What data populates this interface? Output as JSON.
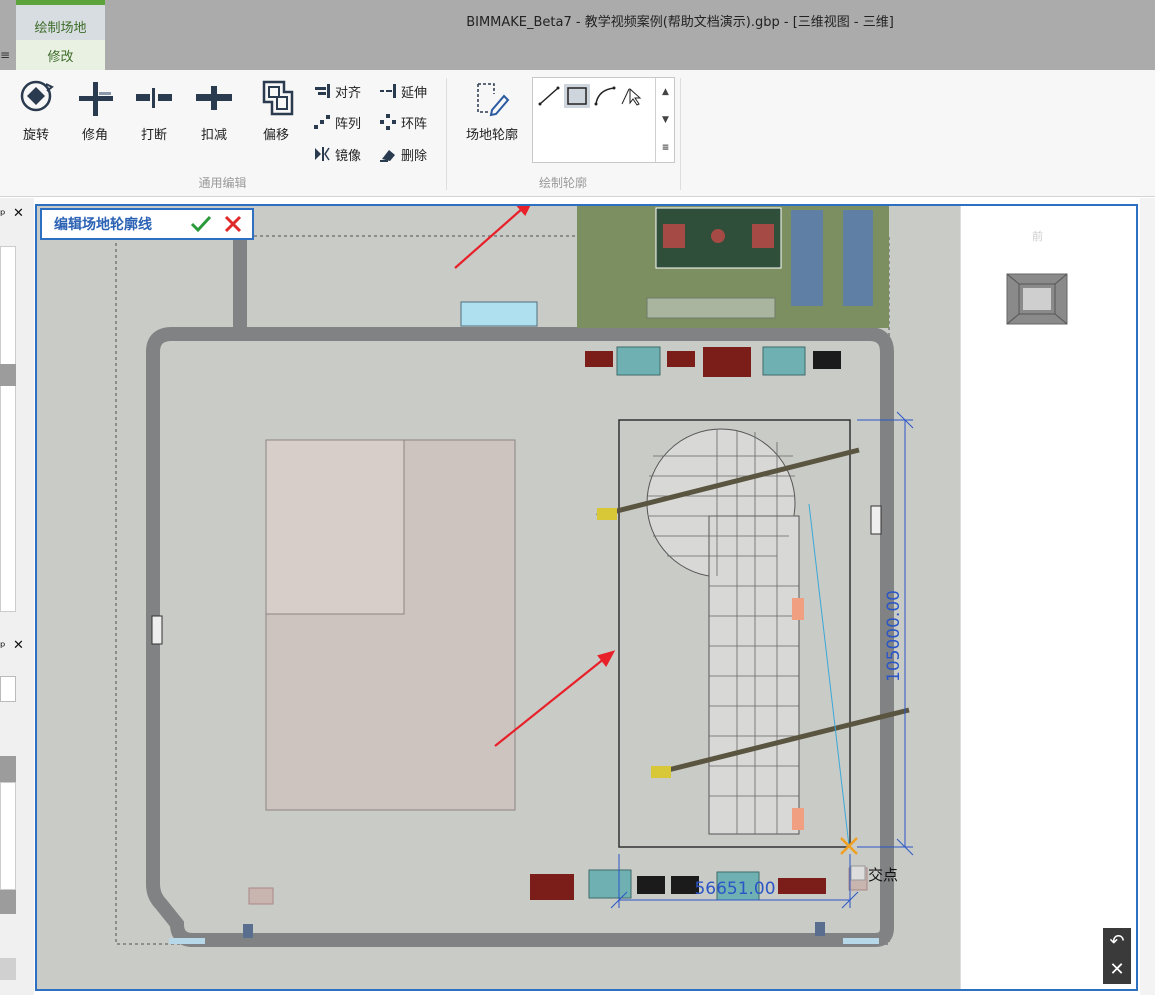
{
  "window": {
    "title": "BIMMAKE_Beta7 - 教学视频案例(帮助文档演示).gbp - [三维视图 - 三维]",
    "edge_glyph": "≡"
  },
  "tabs": [
    {
      "label": "绘制场地",
      "active": false
    },
    {
      "label": "修改",
      "active": true
    }
  ],
  "ribbon": {
    "general_edit": {
      "group_label": "通用编辑",
      "big_buttons": [
        {
          "label": "旋转",
          "icon": "rotate-icon"
        },
        {
          "label": "修角",
          "icon": "trim-corner-icon"
        },
        {
          "label": "打断",
          "icon": "break-icon"
        },
        {
          "label": "扣减",
          "icon": "subtract-icon"
        },
        {
          "label": "偏移",
          "icon": "offset-icon"
        }
      ],
      "small_buttons": [
        {
          "label": "对齐",
          "icon": "align-icon"
        },
        {
          "label": "延伸",
          "icon": "extend-icon"
        },
        {
          "label": "阵列",
          "icon": "array-icon"
        },
        {
          "label": "环阵",
          "icon": "radial-array-icon"
        },
        {
          "label": "镜像",
          "icon": "mirror-icon"
        },
        {
          "label": "删除",
          "icon": "delete-icon"
        }
      ]
    },
    "draw_contour": {
      "group_label": "绘制轮廓",
      "button_label": "场地轮廓",
      "gallery": [
        "line-tool-icon",
        "rectangle-tool-icon",
        "arc-tool-icon",
        "pick-tool-icon"
      ],
      "gallery_selected": "rectangle-tool-icon"
    }
  },
  "viewport": {
    "edit_mode_label": "编辑场地轮廓线",
    "confirm_icon": "check-icon",
    "cancel_icon": "cross-icon",
    "dimension_vertical": "105000.00",
    "dimension_horizontal": "56651.00",
    "snap_label": "交点",
    "nav_hint": "前",
    "undo_icon": "undo-icon",
    "close_icon": "close-icon",
    "accent_color": "#2d6fc0",
    "annotation_arrow_color": "#e8202a",
    "dimension_color": "#2b56c7",
    "snap_color": "#f0a020"
  }
}
